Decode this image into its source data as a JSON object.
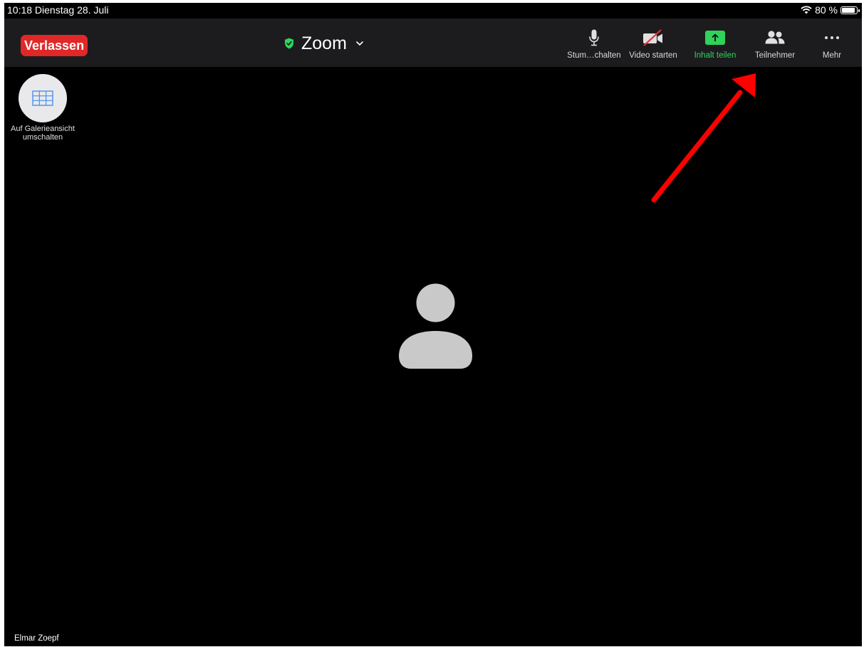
{
  "status_bar": {
    "time_date": "10:18 Dienstag 28. Juli",
    "battery": "80 %"
  },
  "toolbar": {
    "leave_label": "Verlassen",
    "title": "Zoom",
    "items": [
      {
        "label": "Stum…chalten",
        "icon": "microphone-icon"
      },
      {
        "label": "Video starten",
        "icon": "video-off-icon"
      },
      {
        "label": "Inhalt teilen",
        "icon": "share-screen-icon"
      },
      {
        "label": "Teilnehmer",
        "icon": "participants-icon"
      },
      {
        "label": "Mehr",
        "icon": "more-icon"
      }
    ]
  },
  "gallery": {
    "label": "Auf Galerieansicht umschalten"
  },
  "participant": {
    "name": "Elmar Zoepf"
  },
  "colors": {
    "leave": "#e02828",
    "share": "#2fd35c",
    "shield": "#2fd35c",
    "annotation_arrow": "#ff0000"
  }
}
